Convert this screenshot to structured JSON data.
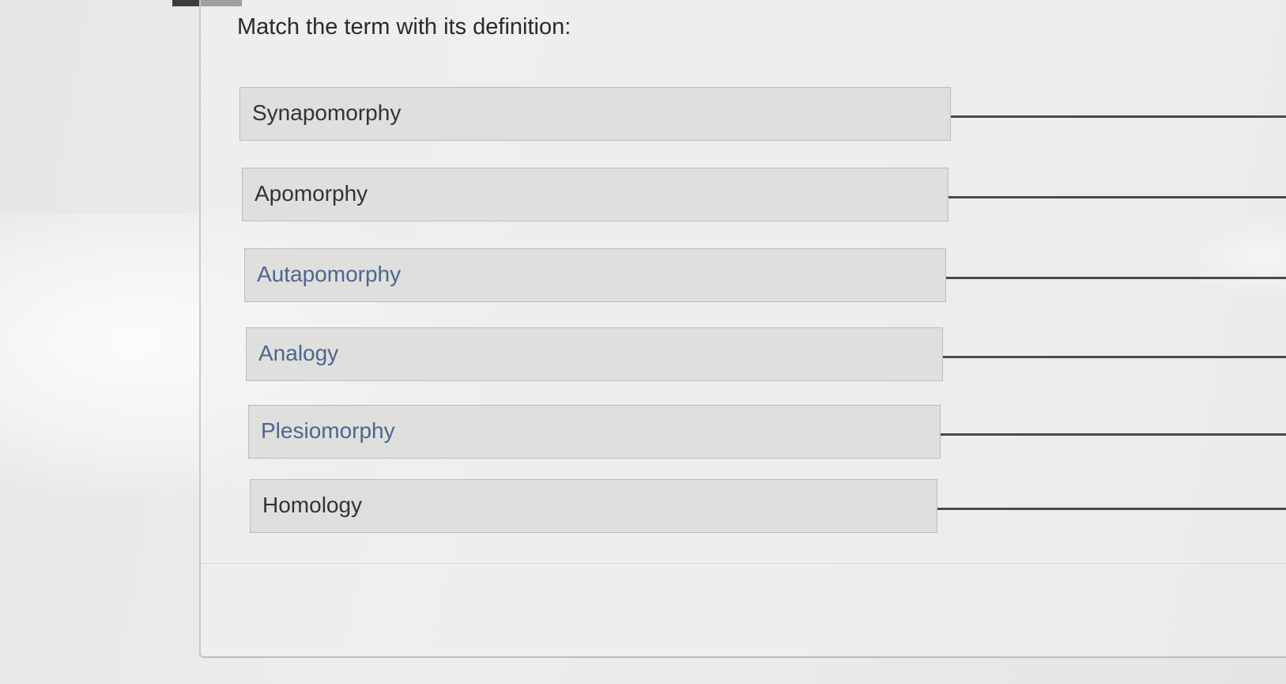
{
  "question": {
    "prompt": "Match the term with its definition:"
  },
  "terms": [
    {
      "label": "Synapomorphy"
    },
    {
      "label": "Apomorphy"
    },
    {
      "label": "Autapomorphy"
    },
    {
      "label": "Analogy"
    },
    {
      "label": "Plesiomorphy"
    },
    {
      "label": "Homology"
    }
  ],
  "colors": {
    "term_box_fill": "#dfdfdd",
    "term_box_border": "#bcbcba",
    "answer_line": "#4a4a4a",
    "text": "#2a2a2a"
  }
}
